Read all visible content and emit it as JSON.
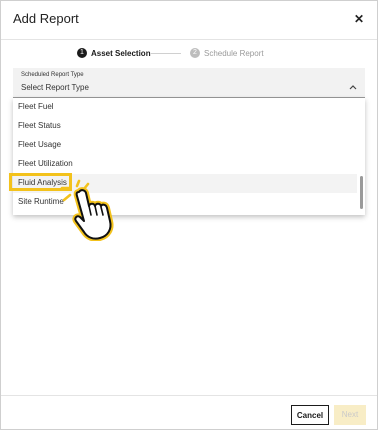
{
  "modal": {
    "title": "Add Report",
    "close_icon": "close-icon"
  },
  "stepper": {
    "steps": [
      {
        "number": "1",
        "label": "Asset Selection",
        "state": "active"
      },
      {
        "number": "2",
        "label": "Schedule Report",
        "state": "inactive"
      }
    ]
  },
  "select": {
    "label": "Scheduled Report Type",
    "value": "Select Report Type",
    "icon": "chevron-up-icon",
    "options": [
      "Fleet Fuel",
      "Fleet Status",
      "Fleet Usage",
      "Fleet Utilization",
      "Fluid Analysis",
      "Site Runtime"
    ],
    "highlighted": "Fluid Analysis"
  },
  "footer": {
    "cancel_label": "Cancel",
    "next_label": "Next"
  },
  "colors": {
    "highlight": "#f3c21c",
    "next_disabled_bg": "#f8edc6",
    "primary": "#1b1b1b"
  },
  "pointer_icon": "pointing-hand-icon"
}
